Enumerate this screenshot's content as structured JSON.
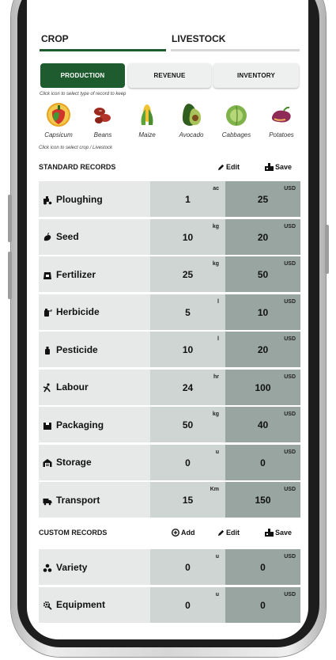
{
  "tabs": {
    "crop": "CROP",
    "livestock": "LIVESTOCK"
  },
  "subtabs": {
    "production": "PRODUCTION",
    "revenue": "REVENUE",
    "inventory": "INVENTORY"
  },
  "hints": {
    "record_type": "Click icon to select  type of record to keep",
    "crop": "Click icon to select crop / Livestock"
  },
  "crops": [
    "Capsicum",
    "Beans",
    "Maize",
    "Avocado",
    "Cabbages",
    "Potatoes"
  ],
  "standard": {
    "title": "STANDARD RECORDS",
    "edit": "Edit",
    "save": "Save",
    "rows": [
      {
        "name": "Ploughing",
        "qty": "1",
        "unit": "ac",
        "cost": "25",
        "currency": "USD"
      },
      {
        "name": "Seed",
        "qty": "10",
        "unit": "kg",
        "cost": "20",
        "currency": "USD"
      },
      {
        "name": "Fertilizer",
        "qty": "25",
        "unit": "kg",
        "cost": "50",
        "currency": "USD"
      },
      {
        "name": "Herbicide",
        "qty": "5",
        "unit": "l",
        "cost": "10",
        "currency": "USD"
      },
      {
        "name": "Pesticide",
        "qty": "10",
        "unit": "l",
        "cost": "20",
        "currency": "USD"
      },
      {
        "name": "Labour",
        "qty": "24",
        "unit": "hr",
        "cost": "100",
        "currency": "USD"
      },
      {
        "name": "Packaging",
        "qty": "50",
        "unit": "kg",
        "cost": "40",
        "currency": "USD"
      },
      {
        "name": "Storage",
        "qty": "0",
        "unit": "u",
        "cost": "0",
        "currency": "USD"
      },
      {
        "name": "Transport",
        "qty": "15",
        "unit": "Km",
        "cost": "150",
        "currency": "USD"
      }
    ]
  },
  "custom": {
    "title": "CUSTOM RECORDS",
    "add": "Add",
    "edit": "Edit",
    "save": "Save",
    "rows": [
      {
        "name": "Variety",
        "qty": "0",
        "unit": "u",
        "cost": "0",
        "currency": "USD"
      },
      {
        "name": "Equipment",
        "qty": "0",
        "unit": "u",
        "cost": "0",
        "currency": "USD"
      }
    ]
  },
  "colors": {
    "accent": "#1e5b2f",
    "qty_cell": "#cfd5d3",
    "cost_cell": "#98a5a1",
    "name_cell": "#e7e9e8"
  }
}
